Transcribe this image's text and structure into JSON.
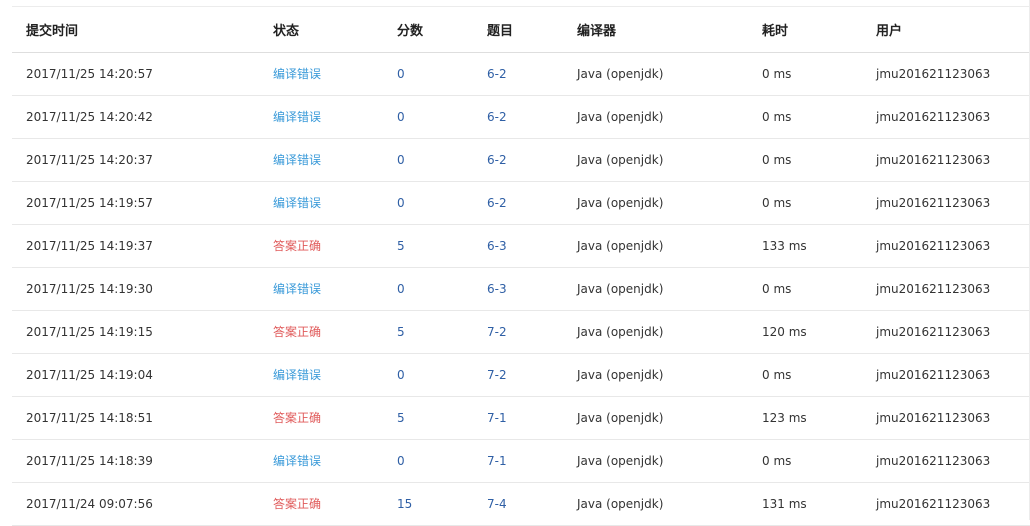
{
  "table": {
    "headers": {
      "time": "提交时间",
      "status": "状态",
      "score": "分数",
      "problem": "题目",
      "compiler": "编译器",
      "duration": "耗时",
      "user": "用户"
    },
    "rows": [
      {
        "time": "2017/11/25 14:20:57",
        "status": "编译错误",
        "status_type": "compile-error",
        "score": "0",
        "problem": "6-2",
        "compiler": "Java (openjdk)",
        "duration": "0 ms",
        "user": "jmu201621123063"
      },
      {
        "time": "2017/11/25 14:20:42",
        "status": "编译错误",
        "status_type": "compile-error",
        "score": "0",
        "problem": "6-2",
        "compiler": "Java (openjdk)",
        "duration": "0 ms",
        "user": "jmu201621123063"
      },
      {
        "time": "2017/11/25 14:20:37",
        "status": "编译错误",
        "status_type": "compile-error",
        "score": "0",
        "problem": "6-2",
        "compiler": "Java (openjdk)",
        "duration": "0 ms",
        "user": "jmu201621123063"
      },
      {
        "time": "2017/11/25 14:19:57",
        "status": "编译错误",
        "status_type": "compile-error",
        "score": "0",
        "problem": "6-2",
        "compiler": "Java (openjdk)",
        "duration": "0 ms",
        "user": "jmu201621123063"
      },
      {
        "time": "2017/11/25 14:19:37",
        "status": "答案正确",
        "status_type": "accepted",
        "score": "5",
        "problem": "6-3",
        "compiler": "Java (openjdk)",
        "duration": "133 ms",
        "user": "jmu201621123063"
      },
      {
        "time": "2017/11/25 14:19:30",
        "status": "编译错误",
        "status_type": "compile-error",
        "score": "0",
        "problem": "6-3",
        "compiler": "Java (openjdk)",
        "duration": "0 ms",
        "user": "jmu201621123063"
      },
      {
        "time": "2017/11/25 14:19:15",
        "status": "答案正确",
        "status_type": "accepted",
        "score": "5",
        "problem": "7-2",
        "compiler": "Java (openjdk)",
        "duration": "120 ms",
        "user": "jmu201621123063"
      },
      {
        "time": "2017/11/25 14:19:04",
        "status": "编译错误",
        "status_type": "compile-error",
        "score": "0",
        "problem": "7-2",
        "compiler": "Java (openjdk)",
        "duration": "0 ms",
        "user": "jmu201621123063"
      },
      {
        "time": "2017/11/25 14:18:51",
        "status": "答案正确",
        "status_type": "accepted",
        "score": "5",
        "problem": "7-1",
        "compiler": "Java (openjdk)",
        "duration": "123 ms",
        "user": "jmu201621123063"
      },
      {
        "time": "2017/11/25 14:18:39",
        "status": "编译错误",
        "status_type": "compile-error",
        "score": "0",
        "problem": "7-1",
        "compiler": "Java (openjdk)",
        "duration": "0 ms",
        "user": "jmu201621123063"
      },
      {
        "time": "2017/11/24 09:07:56",
        "status": "答案正确",
        "status_type": "accepted",
        "score": "15",
        "problem": "7-4",
        "compiler": "Java (openjdk)",
        "duration": "131 ms",
        "user": "jmu201621123063"
      }
    ]
  },
  "colors": {
    "compile_error": "#3a9ad9",
    "accepted": "#e05a5a",
    "link": "#2f5fa5"
  }
}
